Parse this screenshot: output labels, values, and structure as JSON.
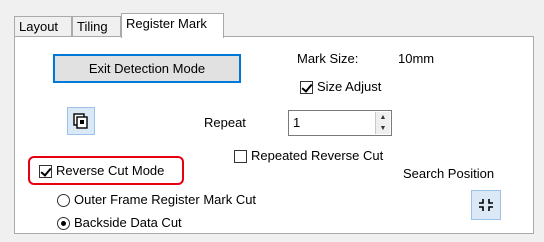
{
  "tabs": [
    {
      "label": "Layout",
      "active": false
    },
    {
      "label": "Tiling",
      "active": false
    },
    {
      "label": "Register Mark",
      "active": true
    }
  ],
  "exit_button": {
    "label": "Exit Detection Mode"
  },
  "mark_size": {
    "label": "Mark Size:",
    "value": "10mm"
  },
  "size_adjust": {
    "label": "Size Adjust",
    "checked": true
  },
  "repeat": {
    "label": "Repeat",
    "value": "1"
  },
  "repeated_reverse_cut": {
    "label": "Repeated Reverse Cut",
    "checked": false
  },
  "reverse_cut_mode": {
    "label": "Reverse Cut Mode",
    "checked": true,
    "highlight_color": "#e60012"
  },
  "search_position": {
    "label": "Search Position"
  },
  "cut_options": [
    {
      "label": "Outer Frame Register Mark Cut",
      "selected": false
    },
    {
      "label": "Backside Data Cut",
      "selected": true
    }
  ],
  "icons": {
    "mark_icon": "register-mark-icon",
    "search_icon": "search-position-icon"
  }
}
